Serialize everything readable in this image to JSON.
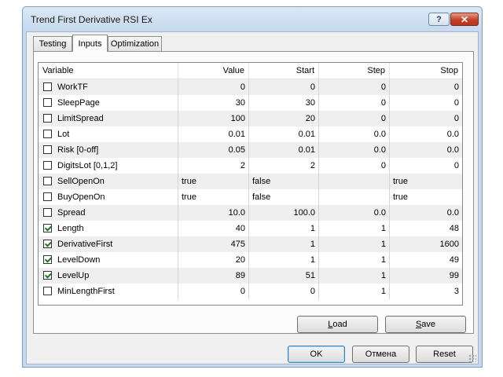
{
  "window": {
    "title": "Trend First Derivative RSI Ex",
    "help_label": "?",
    "close_label": "✕"
  },
  "tabs": [
    {
      "label": "Testing",
      "active": false
    },
    {
      "label": "Inputs",
      "active": true
    },
    {
      "label": "Optimization",
      "active": false
    }
  ],
  "grid": {
    "headers": [
      "Variable",
      "Value",
      "Start",
      "Step",
      "Stop"
    ],
    "rows": [
      {
        "checked": false,
        "name": "WorkTF",
        "value": "0",
        "start": "0",
        "step": "0",
        "stop": "0",
        "text": false
      },
      {
        "checked": false,
        "name": "SleepPage",
        "value": "30",
        "start": "30",
        "step": "0",
        "stop": "0",
        "text": false
      },
      {
        "checked": false,
        "name": "LimitSpread",
        "value": "100",
        "start": "20",
        "step": "0",
        "stop": "0",
        "text": false
      },
      {
        "checked": false,
        "name": "Lot",
        "value": "0.01",
        "start": "0.01",
        "step": "0.0",
        "stop": "0.0",
        "text": false
      },
      {
        "checked": false,
        "name": "Risk [0-off]",
        "value": "0.05",
        "start": "0.01",
        "step": "0.0",
        "stop": "0.0",
        "text": false
      },
      {
        "checked": false,
        "name": "DigitsLot [0,1,2]",
        "value": "2",
        "start": "2",
        "step": "0",
        "stop": "0",
        "text": false
      },
      {
        "checked": false,
        "name": "SellOpenOn",
        "value": "true",
        "start": "false",
        "step": "",
        "stop": "true",
        "text": true
      },
      {
        "checked": false,
        "name": "BuyOpenOn",
        "value": "true",
        "start": "false",
        "step": "",
        "stop": "true",
        "text": true
      },
      {
        "checked": false,
        "name": "Spread",
        "value": "10.0",
        "start": "100.0",
        "step": "0.0",
        "stop": "0.0",
        "text": false
      },
      {
        "checked": true,
        "name": "Length",
        "value": "40",
        "start": "1",
        "step": "1",
        "stop": "48",
        "text": false
      },
      {
        "checked": true,
        "name": "DerivativeFirst",
        "value": "475",
        "start": "1",
        "step": "1",
        "stop": "1600",
        "text": false
      },
      {
        "checked": true,
        "name": "LevelDown",
        "value": "20",
        "start": "1",
        "step": "1",
        "stop": "49",
        "text": false
      },
      {
        "checked": true,
        "name": "LevelUp",
        "value": "89",
        "start": "51",
        "step": "1",
        "stop": "99",
        "text": false
      },
      {
        "checked": false,
        "name": "MinLengthFirst",
        "value": "0",
        "start": "0",
        "step": "1",
        "stop": "3",
        "text": false
      }
    ]
  },
  "buttons": {
    "load_mnemonic": "L",
    "load_rest": "oad",
    "save_mnemonic": "S",
    "save_rest": "ave",
    "ok": "OK",
    "cancel": "Отмена",
    "reset": "Reset"
  }
}
